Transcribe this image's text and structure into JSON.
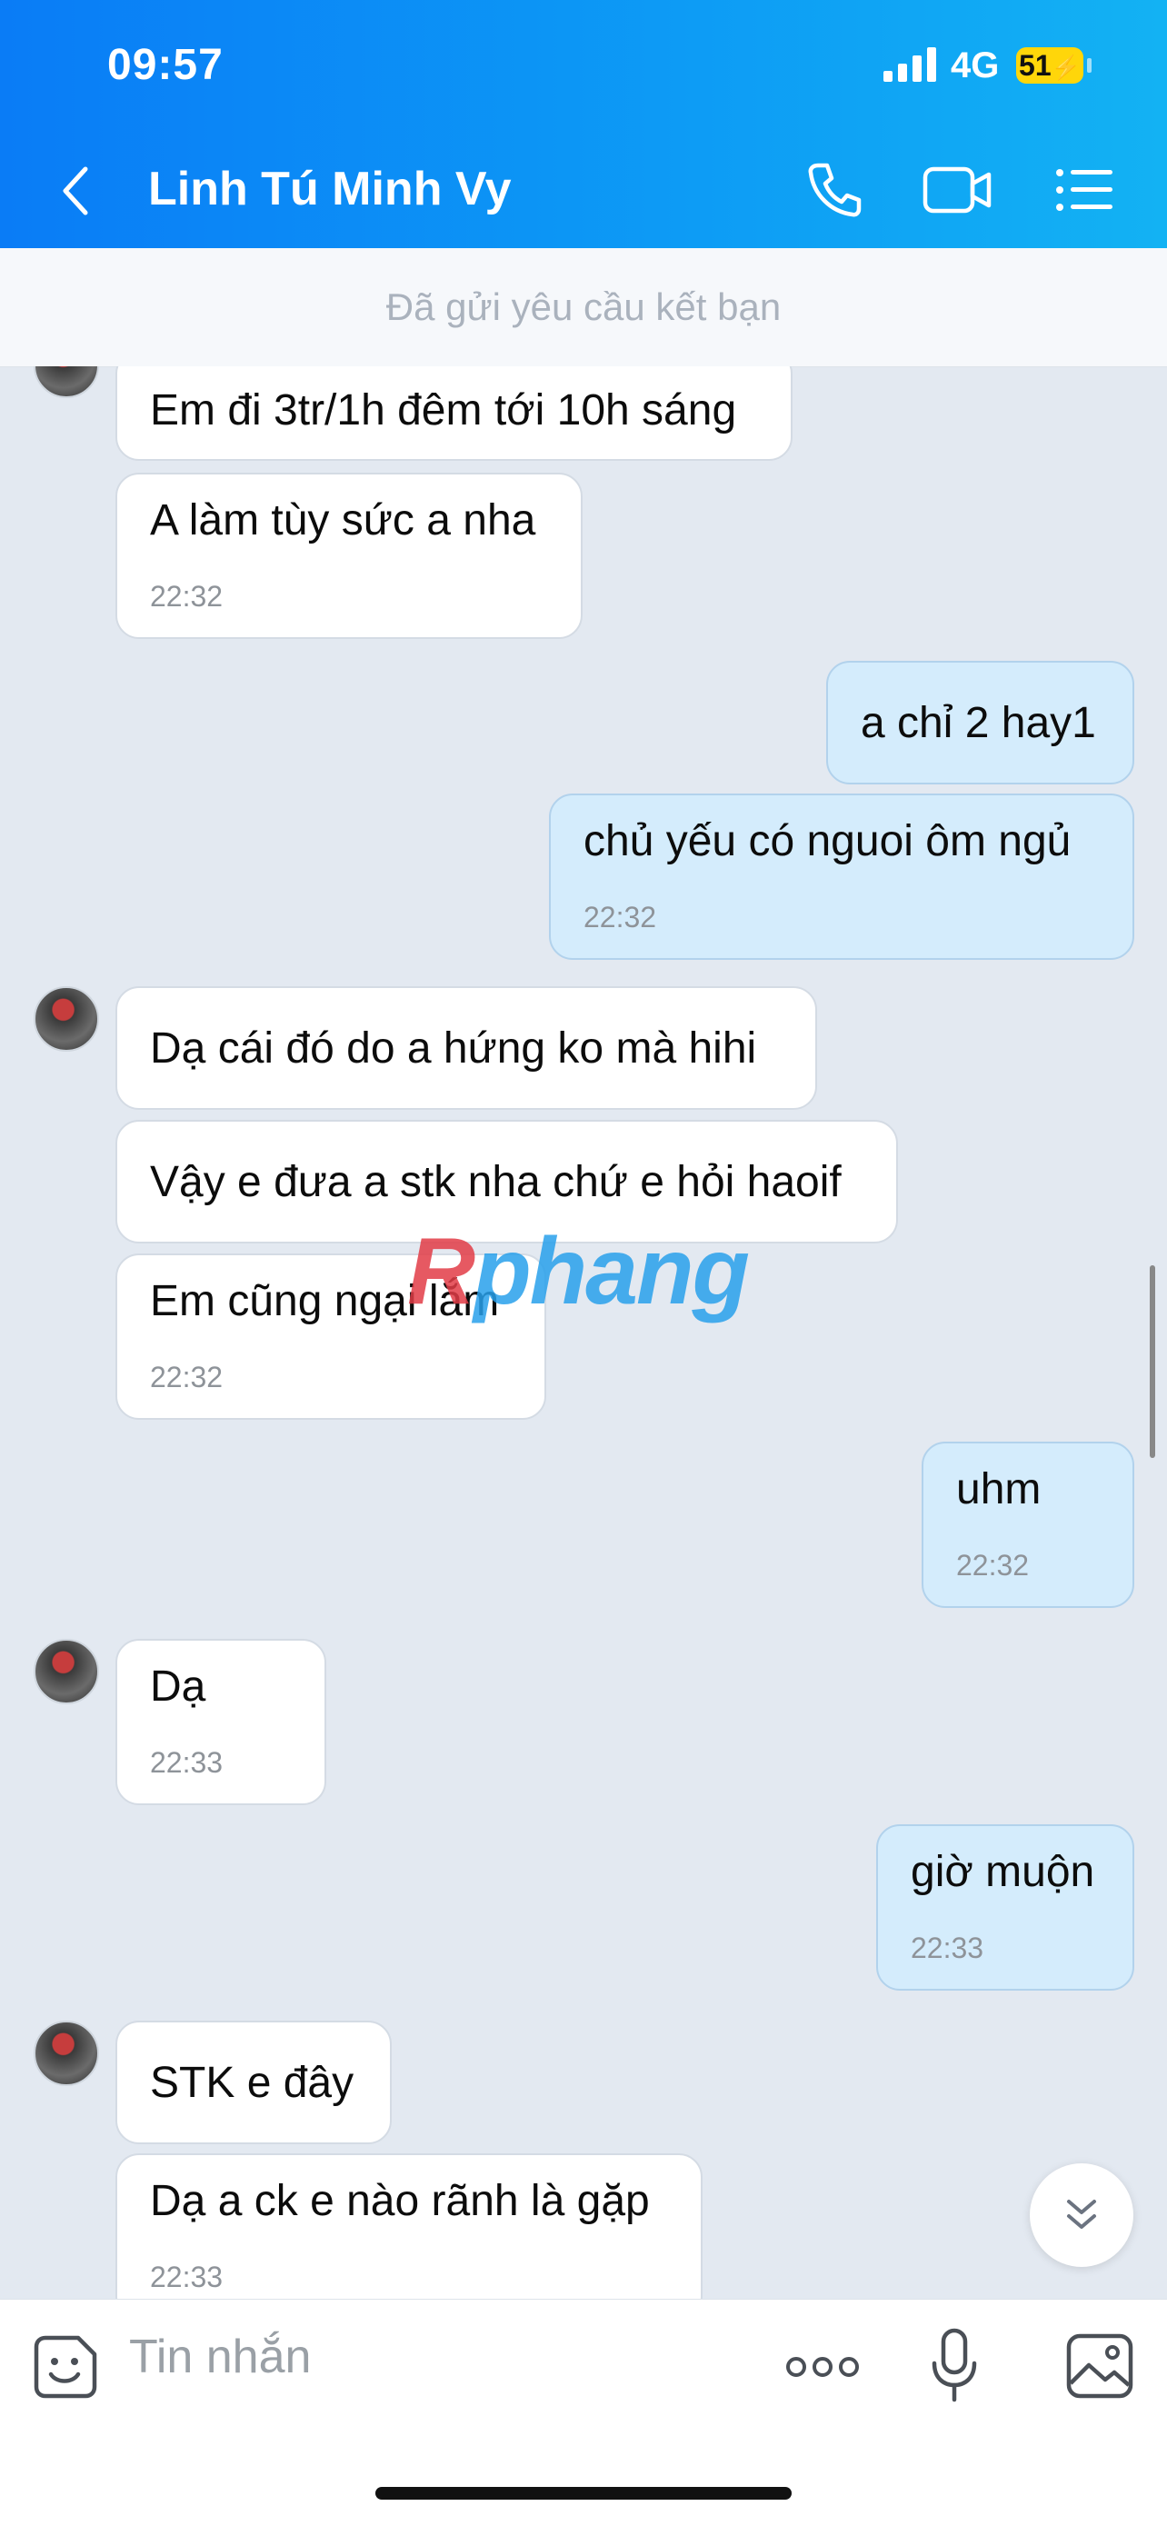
{
  "status_bar": {
    "time": "09:57",
    "network": "4G",
    "battery": "51"
  },
  "header": {
    "contact_name": "Linh Tú Minh Vy"
  },
  "friend_request_notice": "Đã gửi yêu cầu kết bạn",
  "messages": [
    {
      "dir": "in",
      "text": "Em đi 3tr/1h đêm tới 10h sáng"
    },
    {
      "dir": "in",
      "text": "A làm tùy sức a nha",
      "time": "22:32"
    },
    {
      "dir": "out",
      "text": "a chỉ 2 hay1"
    },
    {
      "dir": "out",
      "text": "chủ yếu có nguoi ôm ngủ",
      "time": "22:32"
    },
    {
      "dir": "in",
      "text": "Dạ cái đó do a hứng ko mà hihi"
    },
    {
      "dir": "in",
      "text": "Vậy e đưa a stk nha chứ e hỏi haoif"
    },
    {
      "dir": "in",
      "text": "Em cũng ngại lắm",
      "time": "22:32"
    },
    {
      "dir": "out",
      "text": "uhm",
      "time": "22:32"
    },
    {
      "dir": "in",
      "text": "Dạ",
      "time": "22:33"
    },
    {
      "dir": "out",
      "text": "giờ muộn",
      "time": "22:33"
    },
    {
      "dir": "in",
      "text": "STK e đây"
    },
    {
      "dir": "in",
      "text": "Dạ a ck e nào rãnh là gặp",
      "time": "22:33"
    }
  ],
  "watermark": {
    "part1": "R",
    "part2": "phang"
  },
  "composer": {
    "placeholder": "Tin nhắn"
  },
  "icons": [
    "back-chevron",
    "phone",
    "video-camera",
    "list-menu",
    "sticker-smiley",
    "more-dots",
    "microphone",
    "image-gallery",
    "chevrons-down"
  ]
}
